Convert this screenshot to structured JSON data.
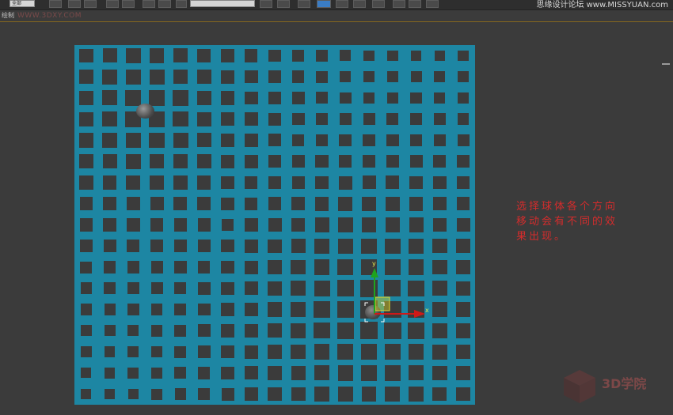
{
  "site_watermark": "思缘设计论坛 www.MISSYUAN.com",
  "viewport": {
    "label": "绘制",
    "url_watermark": "WWW.3DXY.COM"
  },
  "toolbar": {
    "selection_filter": "全部"
  },
  "annotation": {
    "lines": [
      "选择球体各个方向",
      "移动会有不同的效",
      "果出现。"
    ]
  },
  "gizmo": {
    "axis_x": "x",
    "axis_y": "y"
  },
  "corner_logo": {
    "text": "3D学院"
  },
  "colors": {
    "plane": "#1d86a3",
    "background": "#3b3b3b",
    "annotation": "#d42c2c",
    "gizmo_x": "#d01818",
    "gizmo_y": "#1fa31f",
    "gizmo_plane": "#d8d024"
  }
}
